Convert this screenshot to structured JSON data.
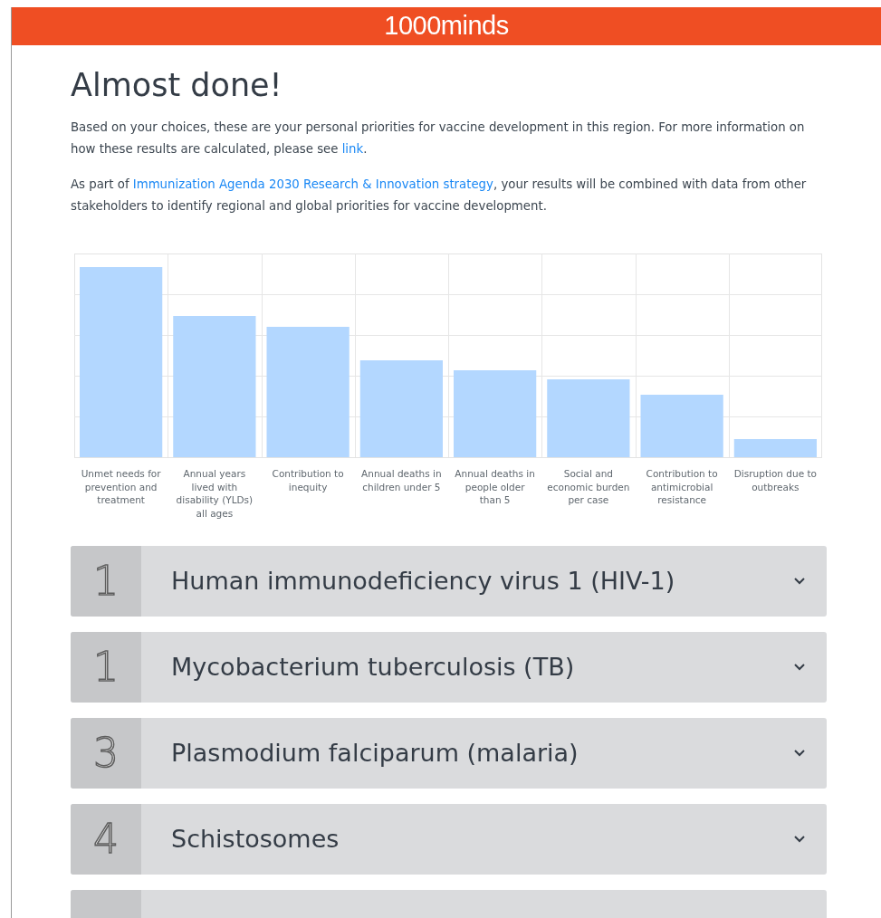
{
  "header": {
    "logo": "1000**minds**"
  },
  "heading": "Almost done!",
  "paragraphs": [
    [
      {
        "text": "Based on your choices, these are your personal priorities for vaccine development in this region. For more information on how these results are calculated, please see "
      },
      {
        "text": "link",
        "link": true
      },
      {
        "text": "."
      }
    ],
    [
      {
        "text": "As part of "
      },
      {
        "text": "Immunization Agenda 2030 Research & Innovation strategy",
        "link": true
      },
      {
        "text": ", your results will be combined with data from other stakeholders to identify regional and global priorities for vaccine development."
      }
    ]
  ],
  "chart": {
    "categories": [
      "Unmet needs for prevention and treatment",
      "Annual years lived with disability (YLDs) all ages",
      "Contribution to inequity",
      "Annual deaths in children under 5",
      "Annual deaths in people older than 5",
      "Social and economic burden per case",
      "Contribution to antimicrobial resistance",
      "Disruption due to outbreaks"
    ]
  },
  "results": [
    {
      "kind": "item",
      "rank": "1",
      "title": "Human immunodeficiency virus 1 (HIV-1)",
      "expanded": false
    },
    {
      "kind": "item",
      "rank": "1",
      "title": "Mycobacterium tuberculosis (TB)",
      "expanded": false
    },
    {
      "kind": "item",
      "rank": "3",
      "title": "Plasmodium falciparum (malaria)",
      "expanded": false
    },
    {
      "kind": "item",
      "rank": "4",
      "title": "Schistosomes",
      "expanded": false
    },
    {
      "kind": "cut"
    }
  ]
}
